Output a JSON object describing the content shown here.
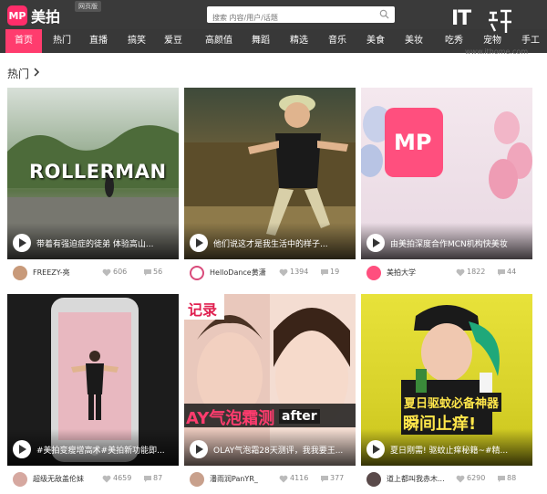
{
  "header": {
    "logo_mark": "MP",
    "logo_text": "美拍",
    "web_badge": "网页版",
    "search_placeholder": "搜索 内容/用户/话题"
  },
  "watermark": {
    "it": "IT",
    "url": "www.ithome.com"
  },
  "nav": {
    "categories": [
      "首页",
      "热门",
      "直播",
      "搞笑",
      "爱豆",
      "高颜值",
      "舞蹈",
      "精选",
      "音乐",
      "美食",
      "美妆",
      "吃秀",
      "宠物",
      "手工"
    ],
    "active_index": 0
  },
  "section": {
    "title": "热门"
  },
  "videos": [
    {
      "caption": "带着有强迫症的徒弟 体验高山...",
      "author": "FREEZY-亮",
      "likes": "606",
      "comments": "56",
      "overlay": "ROLLERMAN"
    },
    {
      "caption": "他们说这才是我生活中的样子...",
      "author": "HelloDance黄潇",
      "likes": "1394",
      "comments": "19",
      "overlay": ""
    },
    {
      "caption": "由美拍深度合作MCN机构快美妆",
      "author": "美拍大学",
      "likes": "1822",
      "comments": "44",
      "overlay": "MP"
    },
    {
      "caption": "#美拍变瘦增高术#美拍新功能即...",
      "author": "超级无敌盖伦妹",
      "likes": "4659",
      "comments": "87",
      "overlay": ""
    },
    {
      "caption": "OLAY气泡霜28天测评，我我要王...",
      "author": "潘雨润PanYR_",
      "likes": "4116",
      "comments": "377",
      "overlay": "after"
    },
    {
      "caption": "夏日刚需! 驱蚊止痒秘籍~#精...",
      "author": "道上都叫我赤木...",
      "likes": "6290",
      "comments": "88",
      "overlay": "夏日驱蚊必备神器"
    }
  ],
  "video_extra": {
    "v3_sticker": "记录",
    "v5_sticker_2": "AY气泡霜测",
    "v6_sub": "瞬间止痒!"
  },
  "colors": {
    "accent": "#ff3c6e",
    "header_bg": "#3a3a3a",
    "nav_bg": "#383838"
  }
}
